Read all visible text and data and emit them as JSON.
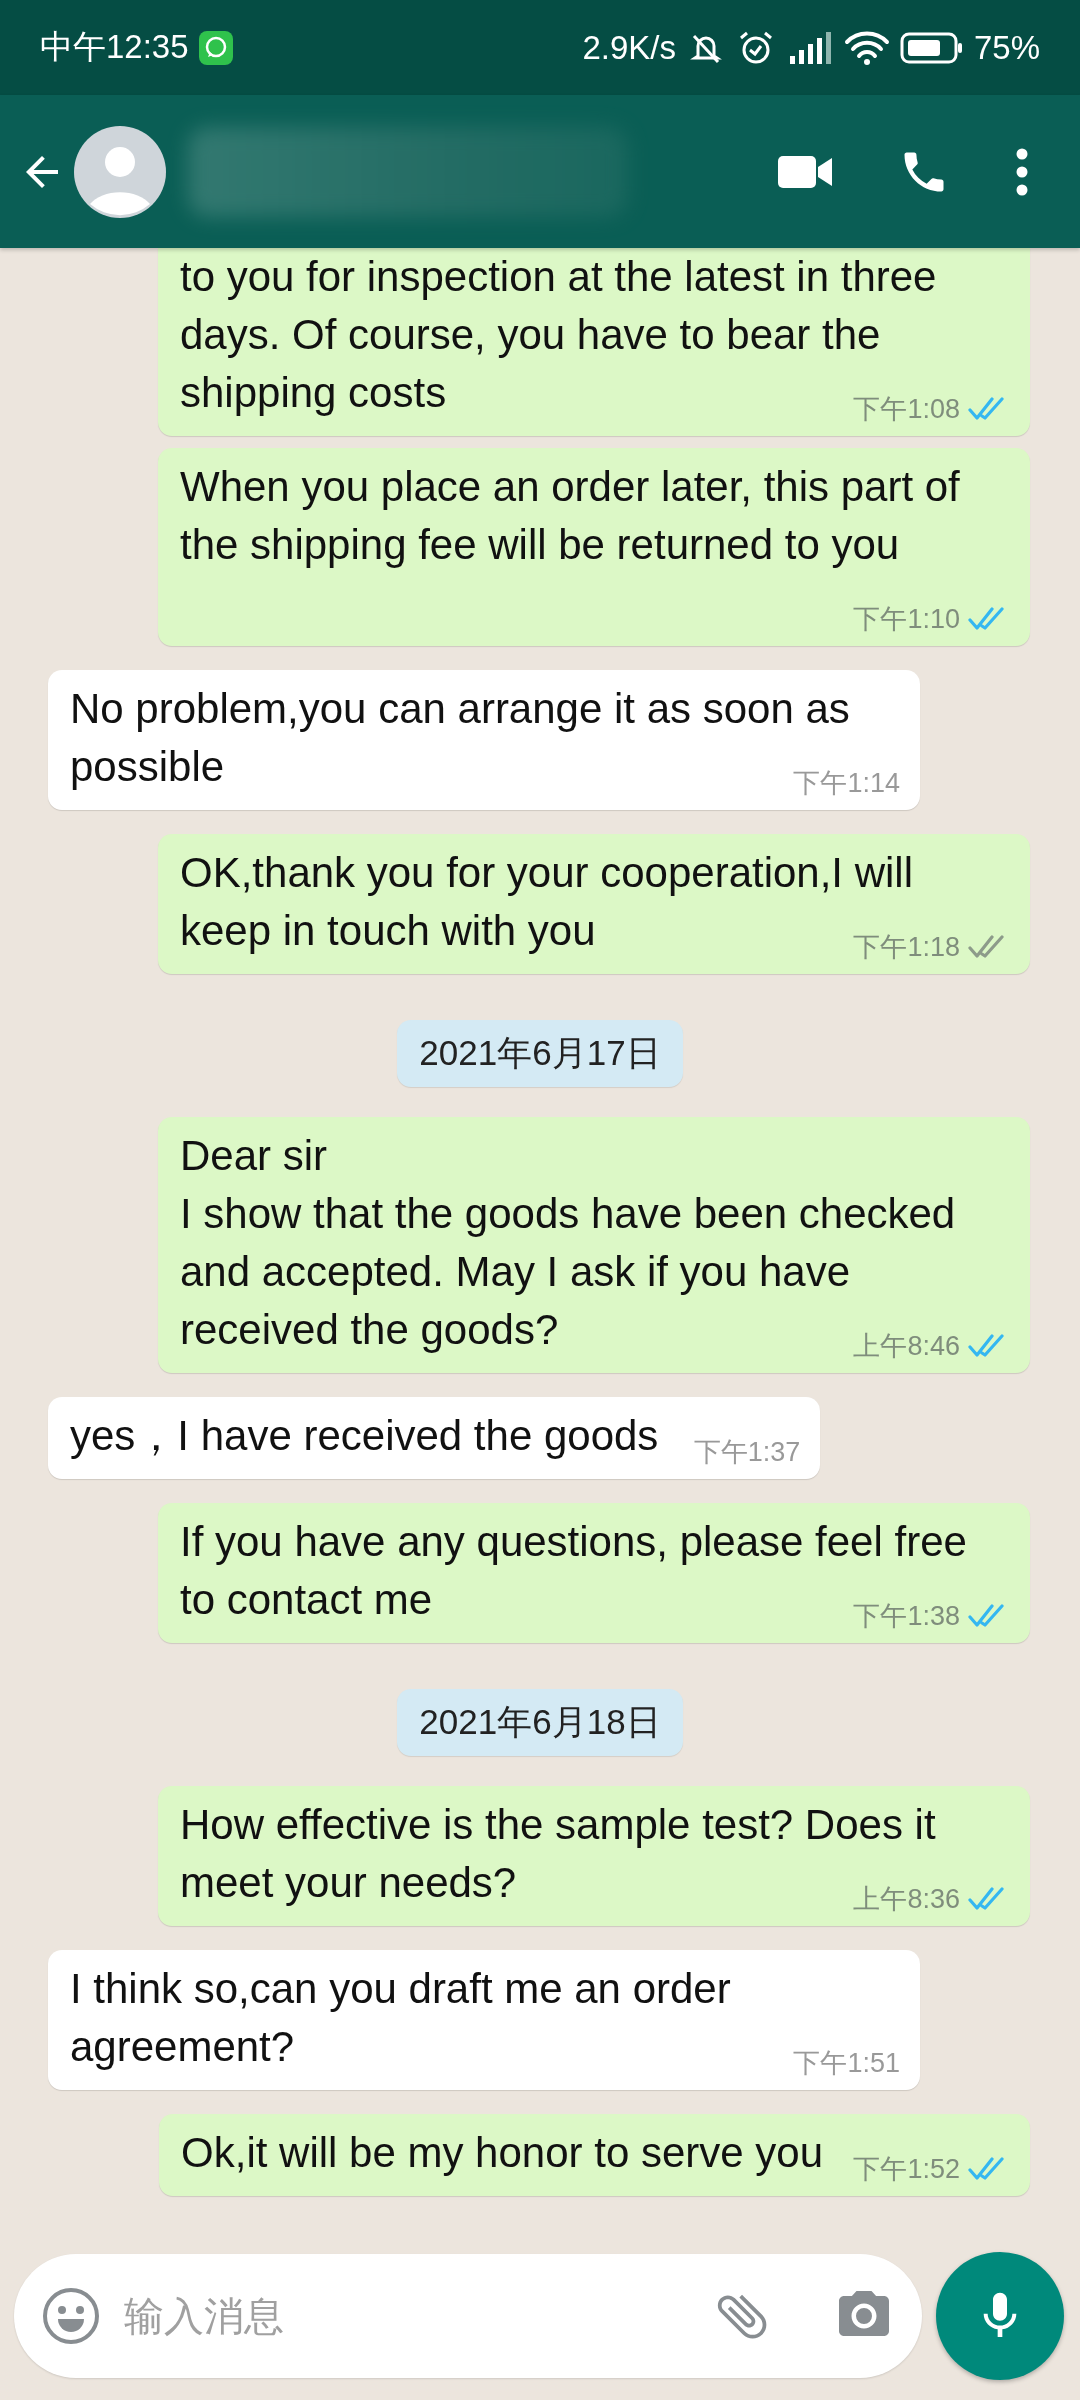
{
  "status_bar": {
    "time": "中午12:35",
    "net_speed": "2.9K/s",
    "battery": "75%"
  },
  "messages": [
    {
      "kind": "message",
      "outgoing": true,
      "text": "to you for inspection at the latest in three days. Of course, you have to bear the shipping costs",
      "time": "下午1:08",
      "read": true
    },
    {
      "kind": "message",
      "outgoing": true,
      "text": "When you place an order later, this part of the shipping fee will be returned to you",
      "time": "下午1:10",
      "read": true
    },
    {
      "kind": "message",
      "outgoing": false,
      "text": "No problem,you can arrange it as soon as possible",
      "time": "下午1:14"
    },
    {
      "kind": "message",
      "outgoing": true,
      "text": "OK,thank you for your cooperation,I will keep in touch with you",
      "time": "下午1:18",
      "read": false
    },
    {
      "kind": "date",
      "text": "2021年6月17日"
    },
    {
      "kind": "message",
      "outgoing": true,
      "text": "Dear sir\nI show that the goods have been checked and accepted. May I ask if you have received the goods?",
      "time": "上午8:46",
      "read": true
    },
    {
      "kind": "message",
      "outgoing": false,
      "text": "yes，I have received the goods",
      "time": "下午1:37"
    },
    {
      "kind": "message",
      "outgoing": true,
      "text": "If you have any questions, please feel free to contact me",
      "time": "下午1:38",
      "read": true
    },
    {
      "kind": "date",
      "text": "2021年6月18日"
    },
    {
      "kind": "message",
      "outgoing": true,
      "text": "How effective is the sample test? Does it meet your needs?",
      "time": "上午8:36",
      "read": true
    },
    {
      "kind": "message",
      "outgoing": false,
      "text": "I think so,can you draft me an order agreement?",
      "time": "下午1:51"
    },
    {
      "kind": "message",
      "outgoing": true,
      "text": "Ok,it will be my honor to serve you",
      "time": "下午1:52",
      "read": true
    }
  ],
  "composer": {
    "placeholder": "输入消息"
  }
}
